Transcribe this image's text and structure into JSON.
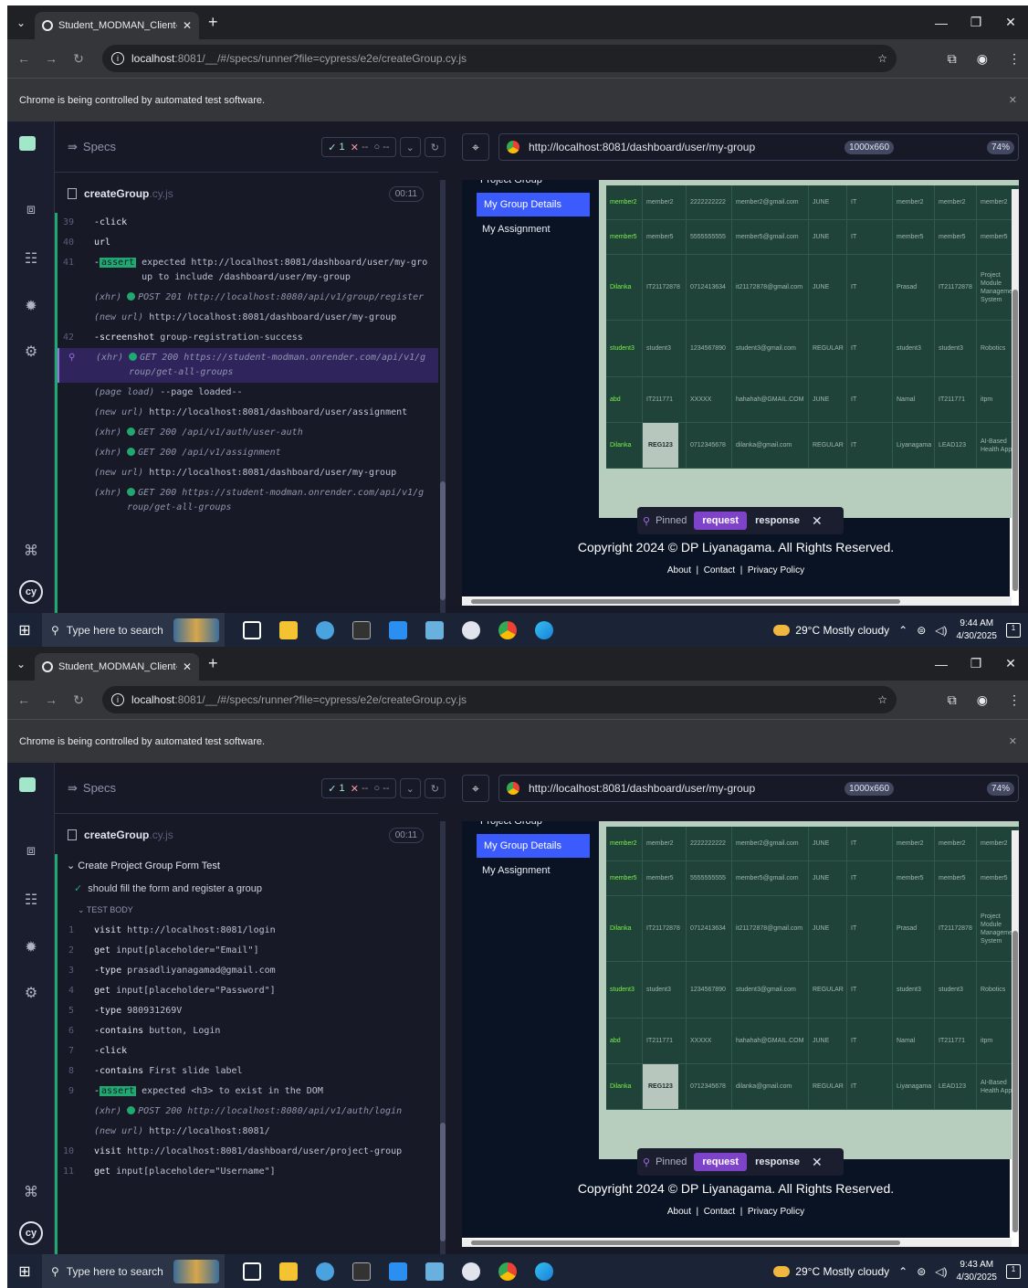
{
  "windows": [
    {
      "tab_title": "Student_MODMAN_Client-main",
      "url_host": "localhost",
      "url_rest": ":8081/__/#/specs/runner?file=cypress/e2e/createGroup.cy.js",
      "infobar": "Chrome is being controlled by automated test software.",
      "specs_label": "Specs",
      "pass_count": "1",
      "fail_label": "--",
      "pending_label": "--",
      "spec_file": "createGroup",
      "spec_ext": ".cy.js",
      "duration": "00:11",
      "aut_url": "http://localhost:8081/dashboard/user/my-group",
      "viewport": "1000x660",
      "zoom": "74%",
      "time": "9:44 AM",
      "date": "4/30/2025",
      "commands": [
        {
          "num": "39",
          "name": "-click",
          "msg": ""
        },
        {
          "num": "40",
          "name": "url",
          "msg": ""
        },
        {
          "num": "41",
          "name": "-assert",
          "msg": "expected http://localhost:8081/dashboard/user/my-group to include /dashboard/user/my-group",
          "assert": true
        },
        {
          "num": "",
          "name": "(xhr)",
          "msg": "POST 201 http://localhost:8080/api/v1/group/register",
          "xhr": true
        },
        {
          "num": "",
          "name": "(new url)",
          "msg": "http://localhost:8081/dashboard/user/my-group",
          "italic": true
        },
        {
          "num": "42",
          "name": "-screenshot",
          "msg": "group-registration-success"
        },
        {
          "num": "",
          "name": "(xhr)",
          "msg": "GET 200 https://student-modman.onrender.com/api/v1/group/get-all-groups",
          "xhr": true,
          "pinned": true
        },
        {
          "num": "",
          "name": "(page load)",
          "msg": "--page loaded--",
          "italic": true
        },
        {
          "num": "",
          "name": "(new url)",
          "msg": "http://localhost:8081/dashboard/user/assignment",
          "italic": true
        },
        {
          "num": "",
          "name": "(xhr)",
          "msg": "GET 200 /api/v1/auth/user-auth",
          "xhr": true
        },
        {
          "num": "",
          "name": "(xhr)",
          "msg": "GET 200 /api/v1/assignment",
          "xhr": true
        },
        {
          "num": "",
          "name": "(new url)",
          "msg": "http://localhost:8081/dashboard/user/my-group",
          "italic": true
        },
        {
          "num": "",
          "name": "(xhr)",
          "msg": "GET 200 https://student-modman.onrender.com/api/v1/group/get-all-groups",
          "xhr": true
        }
      ]
    },
    {
      "tab_title": "Student_MODMAN_Client-main",
      "url_host": "localhost",
      "url_rest": ":8081/__/#/specs/runner?file=cypress/e2e/createGroup.cy.js",
      "infobar": "Chrome is being controlled by automated test software.",
      "specs_label": "Specs",
      "pass_count": "1",
      "fail_label": "--",
      "pending_label": "--",
      "spec_file": "createGroup",
      "spec_ext": ".cy.js",
      "duration": "00:11",
      "aut_url": "http://localhost:8081/dashboard/user/my-group",
      "viewport": "1000x660",
      "zoom": "74%",
      "time": "9:43 AM",
      "date": "4/30/2025",
      "suite": "Create Project Group Form Test",
      "test": "should fill the form and register a group",
      "body_label": "TEST BODY",
      "commands": [
        {
          "num": "1",
          "name": "visit",
          "msg": "http://localhost:8081/login"
        },
        {
          "num": "2",
          "name": "get",
          "msg": "input[placeholder=\"Email\"]"
        },
        {
          "num": "3",
          "name": "-type",
          "msg": "prasadliyanagamad@gmail.com"
        },
        {
          "num": "4",
          "name": "get",
          "msg": "input[placeholder=\"Password\"]"
        },
        {
          "num": "5",
          "name": "-type",
          "msg": "980931269V"
        },
        {
          "num": "6",
          "name": "-contains",
          "msg": "button, Login"
        },
        {
          "num": "7",
          "name": "-click",
          "msg": ""
        },
        {
          "num": "8",
          "name": "-contains",
          "msg": "First slide label"
        },
        {
          "num": "9",
          "name": "-assert",
          "msg": "expected <h3> to exist in the DOM",
          "assert": true
        },
        {
          "num": "",
          "name": "(xhr)",
          "msg": "POST 200 http://localhost:8080/api/v1/auth/login",
          "xhr": true
        },
        {
          "num": "",
          "name": "(new url)",
          "msg": "http://localhost:8081/",
          "italic": true
        },
        {
          "num": "10",
          "name": "visit",
          "msg": "http://localhost:8081/dashboard/user/project-group"
        },
        {
          "num": "11",
          "name": "get",
          "msg": "input[placeholder=\"Username\"]"
        }
      ]
    }
  ],
  "aut": {
    "sidebar_top": "Project Group",
    "sidebar_selected": "My Group Details",
    "sidebar_item": "My Assignment",
    "rows": [
      [
        "member2",
        "member2",
        "2222222222",
        "member2@gmail.com",
        "JUNE",
        "IT",
        "member2",
        "member2",
        "member2"
      ],
      [
        "member5",
        "member5",
        "5555555555",
        "member5@gmail.com",
        "JUNE",
        "IT",
        "member5",
        "member5",
        "member5"
      ],
      [
        "Dilanka",
        "IT21172878",
        "0712413634",
        "it21172878@gmail.com",
        "JUNE",
        "IT",
        "Prasad",
        "IT21172878",
        "Project Module Management System"
      ],
      [
        "student3",
        "student3",
        "1234567890",
        "student3@gmail.com",
        "REGULAR",
        "IT",
        "student3",
        "student3",
        "Robotics"
      ],
      [
        "abd",
        "IT211771",
        "XXXXX",
        "hahahah@GMAIL.COM",
        "JUNE",
        "IT",
        "Namal",
        "IT211771",
        "itpm"
      ],
      [
        "Dilanka",
        "REG123",
        "0712345678",
        "dilanka@gmail.com",
        "REGULAR",
        "IT",
        "Liyanagama",
        "LEAD123",
        "AI-Based Health App"
      ]
    ],
    "copyright": "Copyright 2024 © DP Liyanagama. All Rights Reserved.",
    "footer_about": "About",
    "footer_contact": "Contact",
    "footer_privacy": "Privacy Policy",
    "pinned_label": "Pinned",
    "request_label": "request",
    "response_label": "response"
  },
  "taskbar": {
    "search_placeholder": "Type here to search",
    "weather": "29°C  Mostly cloudy"
  }
}
